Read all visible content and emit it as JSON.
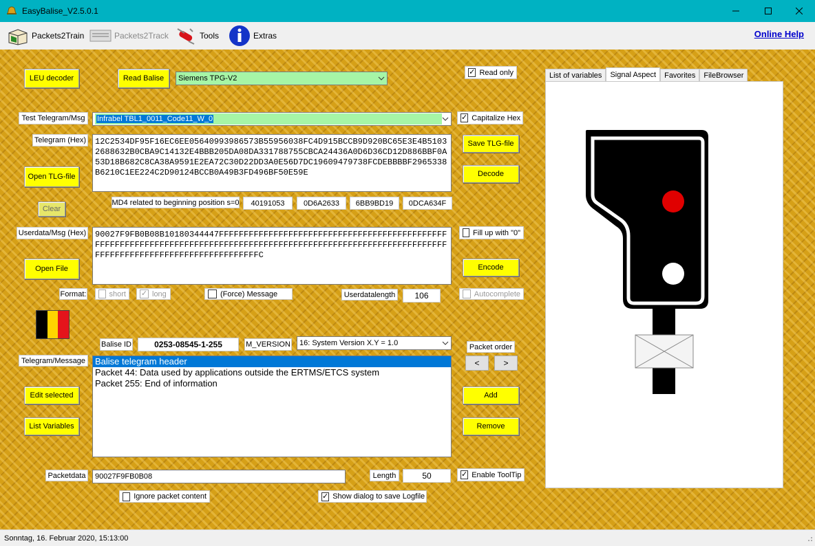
{
  "window": {
    "title": "EasyBalise_V2.5.0.1"
  },
  "menu": {
    "items": [
      {
        "label": "Packets2Train",
        "icon": "box-icon",
        "enabled": true
      },
      {
        "label": "Packets2Track",
        "icon": "keyboard-icon",
        "enabled": false
      },
      {
        "label": "Tools",
        "icon": "swiss-knife-icon",
        "enabled": true
      },
      {
        "label": "Extras",
        "icon": "info-icon",
        "enabled": true
      }
    ],
    "online_help": "Online Help"
  },
  "buttons": {
    "leu_decoder": "LEU decoder",
    "read_balise": "Read Balise",
    "open_tlg_file": "Open TLG-file",
    "clear": "Clear",
    "open_file": "Open File",
    "save_tlg_file": "Save TLG-file",
    "decode": "Decode",
    "encode": "Encode",
    "edit_selected": "Edit selected",
    "list_variables": "List Variables",
    "add": "Add",
    "remove": "Remove",
    "prev": "<",
    "next": ">"
  },
  "reader": {
    "selected": "Siemens TPG-V2",
    "color": "#a6f5a6"
  },
  "labels": {
    "test_telegram": "Test Telegram/Msg",
    "telegram_hex": "Telegram (Hex)",
    "md4": "MD4 related to beginning position s=0",
    "userdata_hex": "Userdata/Msg (Hex)",
    "format": "Format:",
    "userdatalength": "Userdatalength",
    "balise_id": "Balise ID",
    "m_version": "M_VERSION",
    "telegram_message": "Telegram/Message",
    "packet_order": "Packet order",
    "packetdata": "Packetdata",
    "length": "Length"
  },
  "test_telegram": {
    "selected": "Infrabel TBL1_0011_Code11_W_0"
  },
  "telegram_hex": "12C2534DF95F16EC6EE05640993986573B55956038FC4D915BCCB9D920BC65E3E4B51032688632B0CBA9C14132E4BBB205DA08DA331788755CBCA24436A0D6D36CD12D886BBF0A53D18B682C8CA38A9591E2EA72C30D22DD3A0E56D7DC19609479738FCDEBBBBF2965338B6210C1EE224C2D90124BCCB0A49B3FD496BF50E59E",
  "md4_values": [
    "40191053",
    "0D6A2633",
    "6BB9BD19",
    "0DCA634F"
  ],
  "userdata_hex": "90027F9FB0B08B10180344447FFFFFFFFFFFFFFFFFFFFFFFFFFFFFFFFFFFFFFFFFFFFFFFFFFFFFFFFFFFFFFFFFFFFFFFFFFFFFFFFFFFFFFFFFFFFFFFFFFFFFFFFFFFFFFFFFFFFFFFFFFFFFFFFFFFFFFFFFFFFFFFFFFFFFFC",
  "checkboxes": {
    "read_only": {
      "label": "Read only",
      "checked": true
    },
    "capitalize_hex": {
      "label": "Capitalize Hex",
      "checked": true
    },
    "fill_up": {
      "label": "Fill up with \"0\"",
      "checked": false
    },
    "autocomplete": {
      "label": "Autocomplete",
      "checked": false
    },
    "short": {
      "label": "short",
      "checked": false
    },
    "long": {
      "label": "long",
      "checked": true
    },
    "force_message": {
      "label": "(Force) Message",
      "checked": false
    },
    "enable_tooltip": {
      "label": "Enable ToolTip",
      "checked": true
    },
    "ignore_packet": {
      "label": "Ignore packet content",
      "checked": false
    },
    "show_dialog": {
      "label": "Show dialog to save Logfile",
      "checked": true
    }
  },
  "userdatalength": "106",
  "balise_id": "0253-08545-1-255",
  "m_version": "16: System Version X.Y = 1.0",
  "packets": [
    {
      "text": "Balise telegram header",
      "selected": true
    },
    {
      "text": "Packet 44: Data used by applications outside the ERTMS/ETCS system",
      "selected": false
    },
    {
      "text": "Packet 255: End of information",
      "selected": false
    }
  ],
  "packetdata": "90027F9FB0B08",
  "length": "50",
  "tabs": [
    {
      "label": "List of variables",
      "active": false
    },
    {
      "label": "Signal Aspect",
      "active": true
    },
    {
      "label": "Favorites",
      "active": false
    },
    {
      "label": "FileBrowser",
      "active": false
    }
  ],
  "signal": {
    "lamp_top": "#e00000",
    "lamp_bottom": "#ffffff"
  },
  "flag_colors": [
    "#000000",
    "#ffd400",
    "#e4141b"
  ],
  "status": "Sonntag, 16. Februar 2020, 15:13:00"
}
